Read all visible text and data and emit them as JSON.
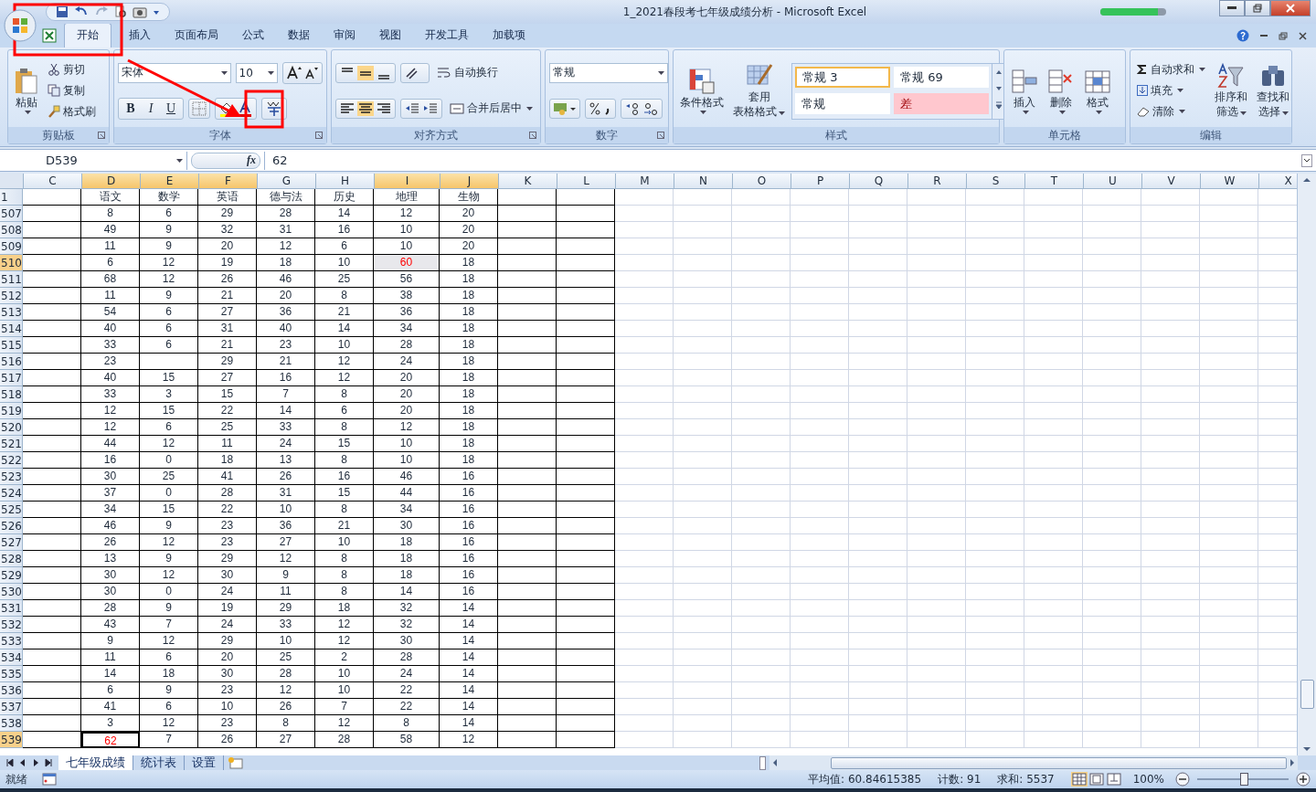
{
  "window": {
    "title": "1_2021春段考七年级成绩分析 - Microsoft Excel"
  },
  "tabs": [
    {
      "label": "开始",
      "selected": true
    },
    {
      "label": "插入",
      "selected": false
    },
    {
      "label": "页面布局",
      "selected": false
    },
    {
      "label": "公式",
      "selected": false
    },
    {
      "label": "数据",
      "selected": false
    },
    {
      "label": "审阅",
      "selected": false
    },
    {
      "label": "视图",
      "selected": false
    },
    {
      "label": "开发工具",
      "selected": false
    },
    {
      "label": "加载项",
      "selected": false
    }
  ],
  "ribbon": {
    "clipboard": {
      "paste": "粘贴",
      "cut": "剪切",
      "copy": "复制",
      "format_painter": "格式刷",
      "label": "剪贴板"
    },
    "font": {
      "font_name": "宋体",
      "font_size": "10",
      "bold": "B",
      "italic": "I",
      "underline": "U",
      "label": "字体"
    },
    "alignment": {
      "wrap_text": "自动换行",
      "merge_center": "合并后居中",
      "label": "对齐方式"
    },
    "number": {
      "format": "常规",
      "label": "数字"
    },
    "styles": {
      "conditional_formatting": "条件格式",
      "table_format_line1": "套用",
      "table_format_line2": "表格格式",
      "gallery": [
        {
          "text": "常规 3",
          "kind": "normal",
          "selected": true
        },
        {
          "text": "常规 69",
          "kind": "normal",
          "selected": false
        },
        {
          "text": "常规",
          "kind": "normal",
          "selected": false
        },
        {
          "text": "差",
          "kind": "bad",
          "selected": false
        }
      ],
      "label": "样式"
    },
    "cells": {
      "insert": "插入",
      "delete": "删除",
      "format": "格式",
      "label": "单元格"
    },
    "editing": {
      "autosum": "自动求和",
      "fill": "填充",
      "clear": "清除",
      "sort_line1": "排序和",
      "sort_line2": "筛选",
      "find_line1": "查找和",
      "find_line2": "选择",
      "label": "编辑"
    }
  },
  "formula_bar": {
    "name_box": "D539",
    "fx": "fx",
    "value": "62"
  },
  "columns": [
    {
      "letter": "C",
      "selected": false
    },
    {
      "letter": "D",
      "selected": true
    },
    {
      "letter": "E",
      "selected": true
    },
    {
      "letter": "F",
      "selected": true
    },
    {
      "letter": "G",
      "selected": false
    },
    {
      "letter": "H",
      "selected": false
    },
    {
      "letter": "I",
      "selected": true
    },
    {
      "letter": "J",
      "selected": true
    },
    {
      "letter": "K",
      "selected": false
    },
    {
      "letter": "L",
      "selected": false
    },
    {
      "letter": "M",
      "selected": false
    },
    {
      "letter": "N",
      "selected": false
    },
    {
      "letter": "O",
      "selected": false
    },
    {
      "letter": "P",
      "selected": false
    },
    {
      "letter": "Q",
      "selected": false
    },
    {
      "letter": "R",
      "selected": false
    },
    {
      "letter": "S",
      "selected": false
    },
    {
      "letter": "T",
      "selected": false
    },
    {
      "letter": "U",
      "selected": false
    },
    {
      "letter": "V",
      "selected": false
    },
    {
      "letter": "W",
      "selected": false
    },
    {
      "letter": "X",
      "selected": false
    }
  ],
  "rows": [
    {
      "num": "1",
      "selected": false,
      "cells": [
        "语文",
        "数学",
        "英语",
        "德与法",
        "历史",
        "地理",
        "生物"
      ]
    },
    {
      "num": "507",
      "selected": false,
      "cells": [
        "8",
        "6",
        "29",
        "28",
        "14",
        "12",
        "20"
      ]
    },
    {
      "num": "508",
      "selected": false,
      "cells": [
        "49",
        "9",
        "32",
        "31",
        "16",
        "10",
        "20"
      ]
    },
    {
      "num": "509",
      "selected": false,
      "cells": [
        "11",
        "9",
        "20",
        "12",
        "6",
        "10",
        "20"
      ]
    },
    {
      "num": "510",
      "selected": true,
      "cells": [
        "6",
        "12",
        "19",
        "18",
        "10",
        {
          "text": "60",
          "alert": true,
          "shaded": true,
          "active": false
        },
        "18"
      ]
    },
    {
      "num": "511",
      "selected": false,
      "cells": [
        "68",
        "12",
        "26",
        "46",
        "25",
        "56",
        "18"
      ]
    },
    {
      "num": "512",
      "selected": false,
      "cells": [
        "11",
        "9",
        "21",
        "20",
        "8",
        "38",
        "18"
      ]
    },
    {
      "num": "513",
      "selected": false,
      "cells": [
        "54",
        "6",
        "27",
        "36",
        "21",
        "36",
        "18"
      ]
    },
    {
      "num": "514",
      "selected": false,
      "cells": [
        "40",
        "6",
        "31",
        "40",
        "14",
        "34",
        "18"
      ]
    },
    {
      "num": "515",
      "selected": false,
      "cells": [
        "33",
        "6",
        "21",
        "23",
        "10",
        "28",
        "18"
      ]
    },
    {
      "num": "516",
      "selected": false,
      "cells": [
        "23",
        null,
        "29",
        "21",
        "12",
        "24",
        "18"
      ]
    },
    {
      "num": "517",
      "selected": false,
      "cells": [
        "40",
        "15",
        "27",
        "16",
        "12",
        "20",
        "18"
      ]
    },
    {
      "num": "518",
      "selected": false,
      "cells": [
        "33",
        "3",
        "15",
        "7",
        "8",
        "20",
        "18"
      ]
    },
    {
      "num": "519",
      "selected": false,
      "cells": [
        "12",
        "15",
        "22",
        "14",
        "6",
        "20",
        "18"
      ]
    },
    {
      "num": "520",
      "selected": false,
      "cells": [
        "12",
        "6",
        "25",
        "33",
        "8",
        "12",
        "18"
      ]
    },
    {
      "num": "521",
      "selected": false,
      "cells": [
        "44",
        "12",
        "11",
        "24",
        "15",
        "10",
        "18"
      ]
    },
    {
      "num": "522",
      "selected": false,
      "cells": [
        "16",
        "0",
        "18",
        "13",
        "8",
        "10",
        "18"
      ]
    },
    {
      "num": "523",
      "selected": false,
      "cells": [
        "30",
        "25",
        "41",
        "26",
        "16",
        "46",
        "16"
      ]
    },
    {
      "num": "524",
      "selected": false,
      "cells": [
        "37",
        "0",
        "28",
        "31",
        "15",
        "44",
        "16"
      ]
    },
    {
      "num": "525",
      "selected": false,
      "cells": [
        "34",
        "15",
        "22",
        "10",
        "8",
        "34",
        "16"
      ]
    },
    {
      "num": "526",
      "selected": false,
      "cells": [
        "46",
        "9",
        "23",
        "36",
        "21",
        "30",
        "16"
      ]
    },
    {
      "num": "527",
      "selected": false,
      "cells": [
        "26",
        "12",
        "23",
        "27",
        "10",
        "18",
        "16"
      ]
    },
    {
      "num": "528",
      "selected": false,
      "cells": [
        "13",
        "9",
        "29",
        "12",
        "8",
        "18",
        "16"
      ]
    },
    {
      "num": "529",
      "selected": false,
      "cells": [
        "30",
        "12",
        "30",
        "9",
        "8",
        "18",
        "16"
      ]
    },
    {
      "num": "530",
      "selected": false,
      "cells": [
        "30",
        "0",
        "24",
        "11",
        "8",
        "14",
        "16"
      ]
    },
    {
      "num": "531",
      "selected": false,
      "cells": [
        "28",
        "9",
        "19",
        "29",
        "18",
        "32",
        "14"
      ]
    },
    {
      "num": "532",
      "selected": false,
      "cells": [
        "43",
        "7",
        "24",
        "33",
        "12",
        "32",
        "14"
      ]
    },
    {
      "num": "533",
      "selected": false,
      "cells": [
        "9",
        "12",
        "29",
        "10",
        "12",
        "30",
        "14"
      ]
    },
    {
      "num": "534",
      "selected": false,
      "cells": [
        "11",
        "6",
        "20",
        "25",
        "2",
        "28",
        "14"
      ]
    },
    {
      "num": "535",
      "selected": false,
      "cells": [
        "14",
        "18",
        "30",
        "28",
        "10",
        "24",
        "14"
      ]
    },
    {
      "num": "536",
      "selected": false,
      "cells": [
        "6",
        "9",
        "23",
        "12",
        "10",
        "22",
        "14"
      ]
    },
    {
      "num": "537",
      "selected": false,
      "cells": [
        "41",
        "6",
        "10",
        "26",
        "7",
        "22",
        "14"
      ]
    },
    {
      "num": "538",
      "selected": false,
      "cells": [
        "3",
        "12",
        "23",
        "8",
        "12",
        "8",
        "14"
      ]
    },
    {
      "num": "539",
      "selected": true,
      "cells": [
        {
          "text": "62",
          "alert": true,
          "shaded": false,
          "active": true
        },
        "7",
        "26",
        "27",
        "28",
        "58",
        "12"
      ]
    }
  ],
  "sheet_tabs": [
    {
      "label": "七年级成绩",
      "selected": true
    },
    {
      "label": "统计表",
      "selected": false
    },
    {
      "label": "设置",
      "selected": false
    }
  ],
  "status_bar": {
    "mode": "就绪",
    "average": "平均值: 60.84615385",
    "count": "计数: 91",
    "sum": "求和: 5537",
    "zoom": "100%",
    "zoom_slider": {
      "level": 0.5
    }
  }
}
